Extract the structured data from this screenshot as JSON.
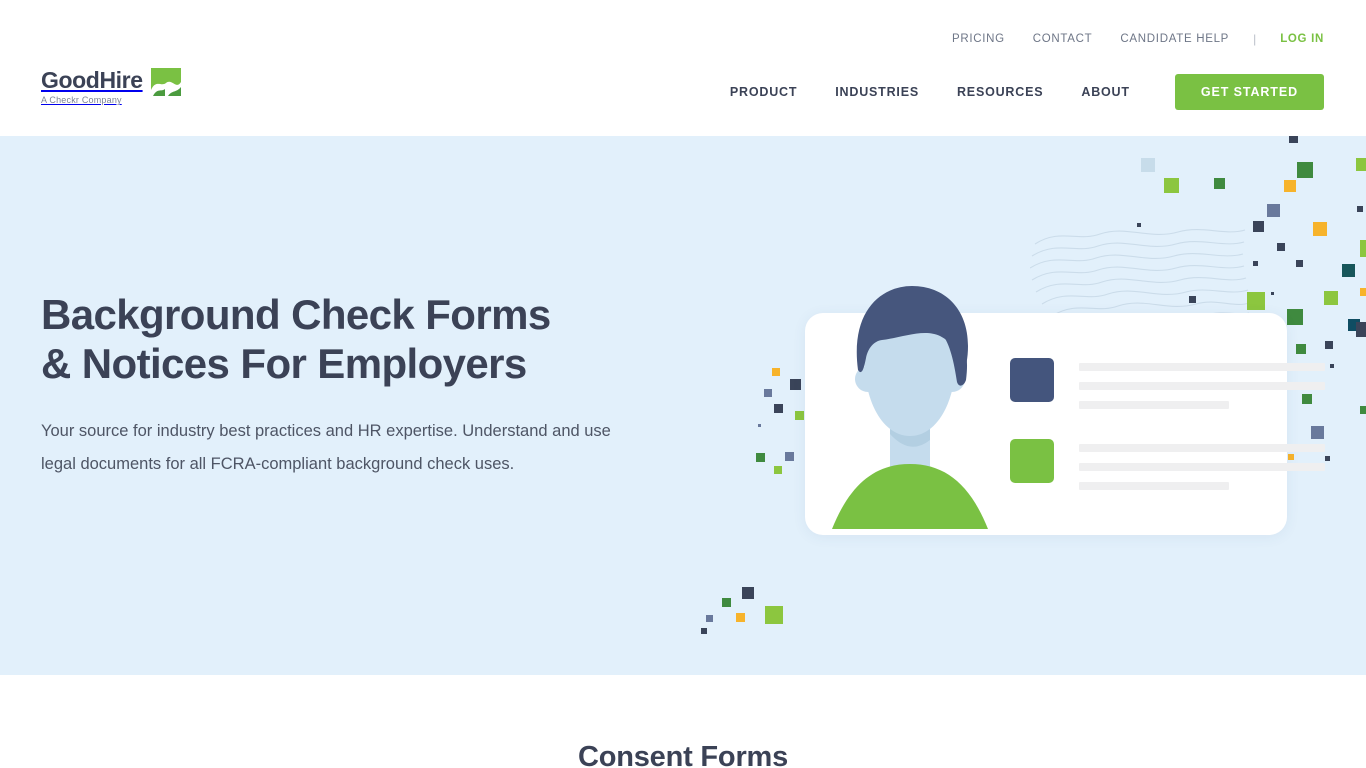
{
  "brand": {
    "name": "GoodHire",
    "tagline": "A Checkr Company",
    "logo_icon": "goodhire-green-check-mark",
    "accent_green": "#7ac143",
    "navy": "#3b4256",
    "hero_bg": "#e2f0fb"
  },
  "header": {
    "top_nav": [
      {
        "label": "PRICING",
        "name": "pricing"
      },
      {
        "label": "CONTACT",
        "name": "contact"
      },
      {
        "label": "CANDIDATE HELP",
        "name": "candidate-help"
      }
    ],
    "divider": "|",
    "login_label": "LOG IN",
    "main_nav": [
      {
        "label": "PRODUCT",
        "name": "product"
      },
      {
        "label": "INDUSTRIES",
        "name": "industries"
      },
      {
        "label": "RESOURCES",
        "name": "resources"
      },
      {
        "label": "ABOUT",
        "name": "about"
      }
    ],
    "cta_label": "GET STARTED"
  },
  "hero": {
    "heading_line1": "Background Check Forms",
    "heading_line2": "& Notices For Employers",
    "paragraph": "Your source for industry best practices and HR expertise. Understand and use legal documents for all FCRA-compliant background check uses.",
    "illustration": {
      "name": "id-card-with-avatar-illustration",
      "card_bg": "#ffffff",
      "avatar_hair": "#46567d",
      "avatar_skin": "#c5dced",
      "avatar_shirt": "#7ac143",
      "chip_navy": "#44557d",
      "chip_green": "#7ac143",
      "line_gray": "#efeff0"
    },
    "decor_palette": {
      "green_light": "#8cc63f",
      "green_dark": "#3f8a3f",
      "navy": "#3a4459",
      "slate": "#69799c",
      "orange": "#f7b32b",
      "teal": "#18564f",
      "pale_blue": "#c7dcea"
    }
  },
  "below_hero": {
    "section_title": "Consent Forms"
  }
}
